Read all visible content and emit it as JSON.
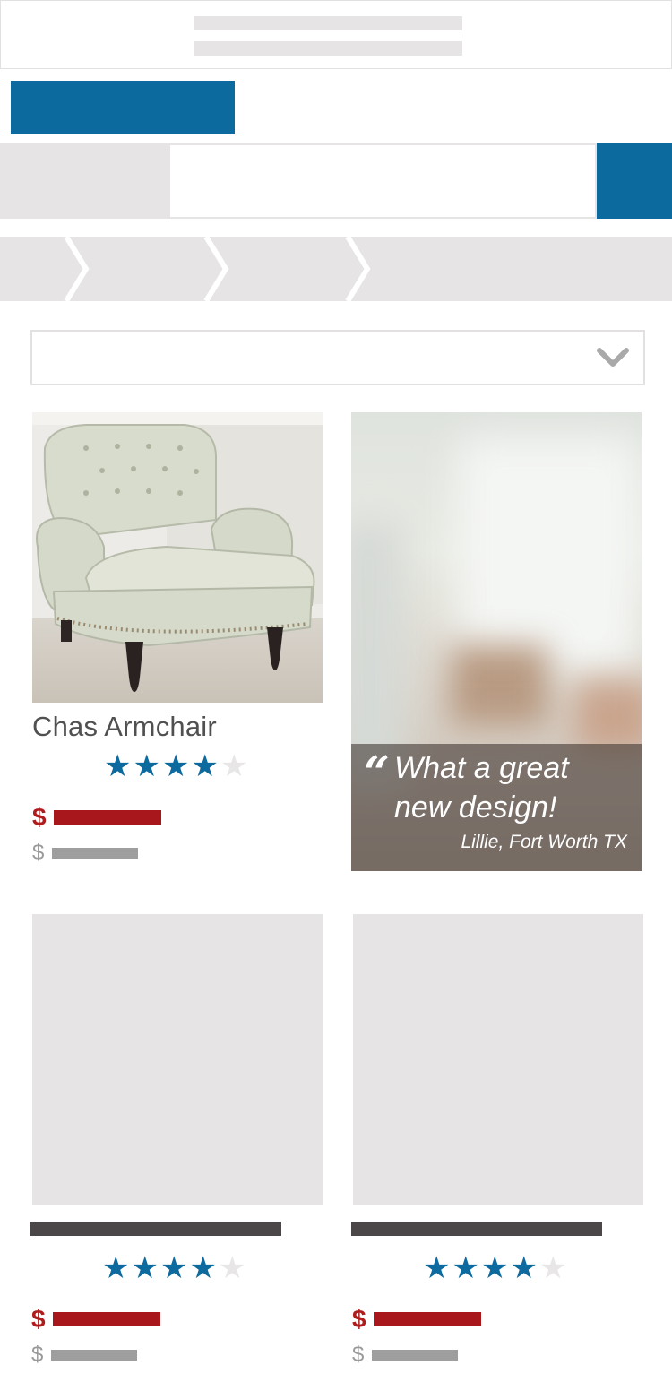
{
  "colors": {
    "brand_blue": "#0d6a9e",
    "sale_red": "#a8171b",
    "placeholder_gray": "#e6e4e5"
  },
  "search": {
    "placeholder": ""
  },
  "products": [
    {
      "title": "Chas Armchair",
      "rating": 4,
      "max_rating": 5,
      "sale_currency": "$",
      "regular_currency": "$"
    },
    {
      "title": "",
      "rating": 4,
      "max_rating": 5,
      "sale_currency": "$",
      "regular_currency": "$"
    },
    {
      "title": "",
      "rating": 4,
      "max_rating": 5,
      "sale_currency": "$",
      "regular_currency": "$"
    }
  ],
  "testimonial": {
    "quote_mark": "“",
    "quote_line1": "What a great",
    "quote_line2": "new design!",
    "author": "Lillie, Fort Worth TX"
  },
  "icons": {
    "dropdown": "chevron-down-icon",
    "star": "star-icon"
  }
}
